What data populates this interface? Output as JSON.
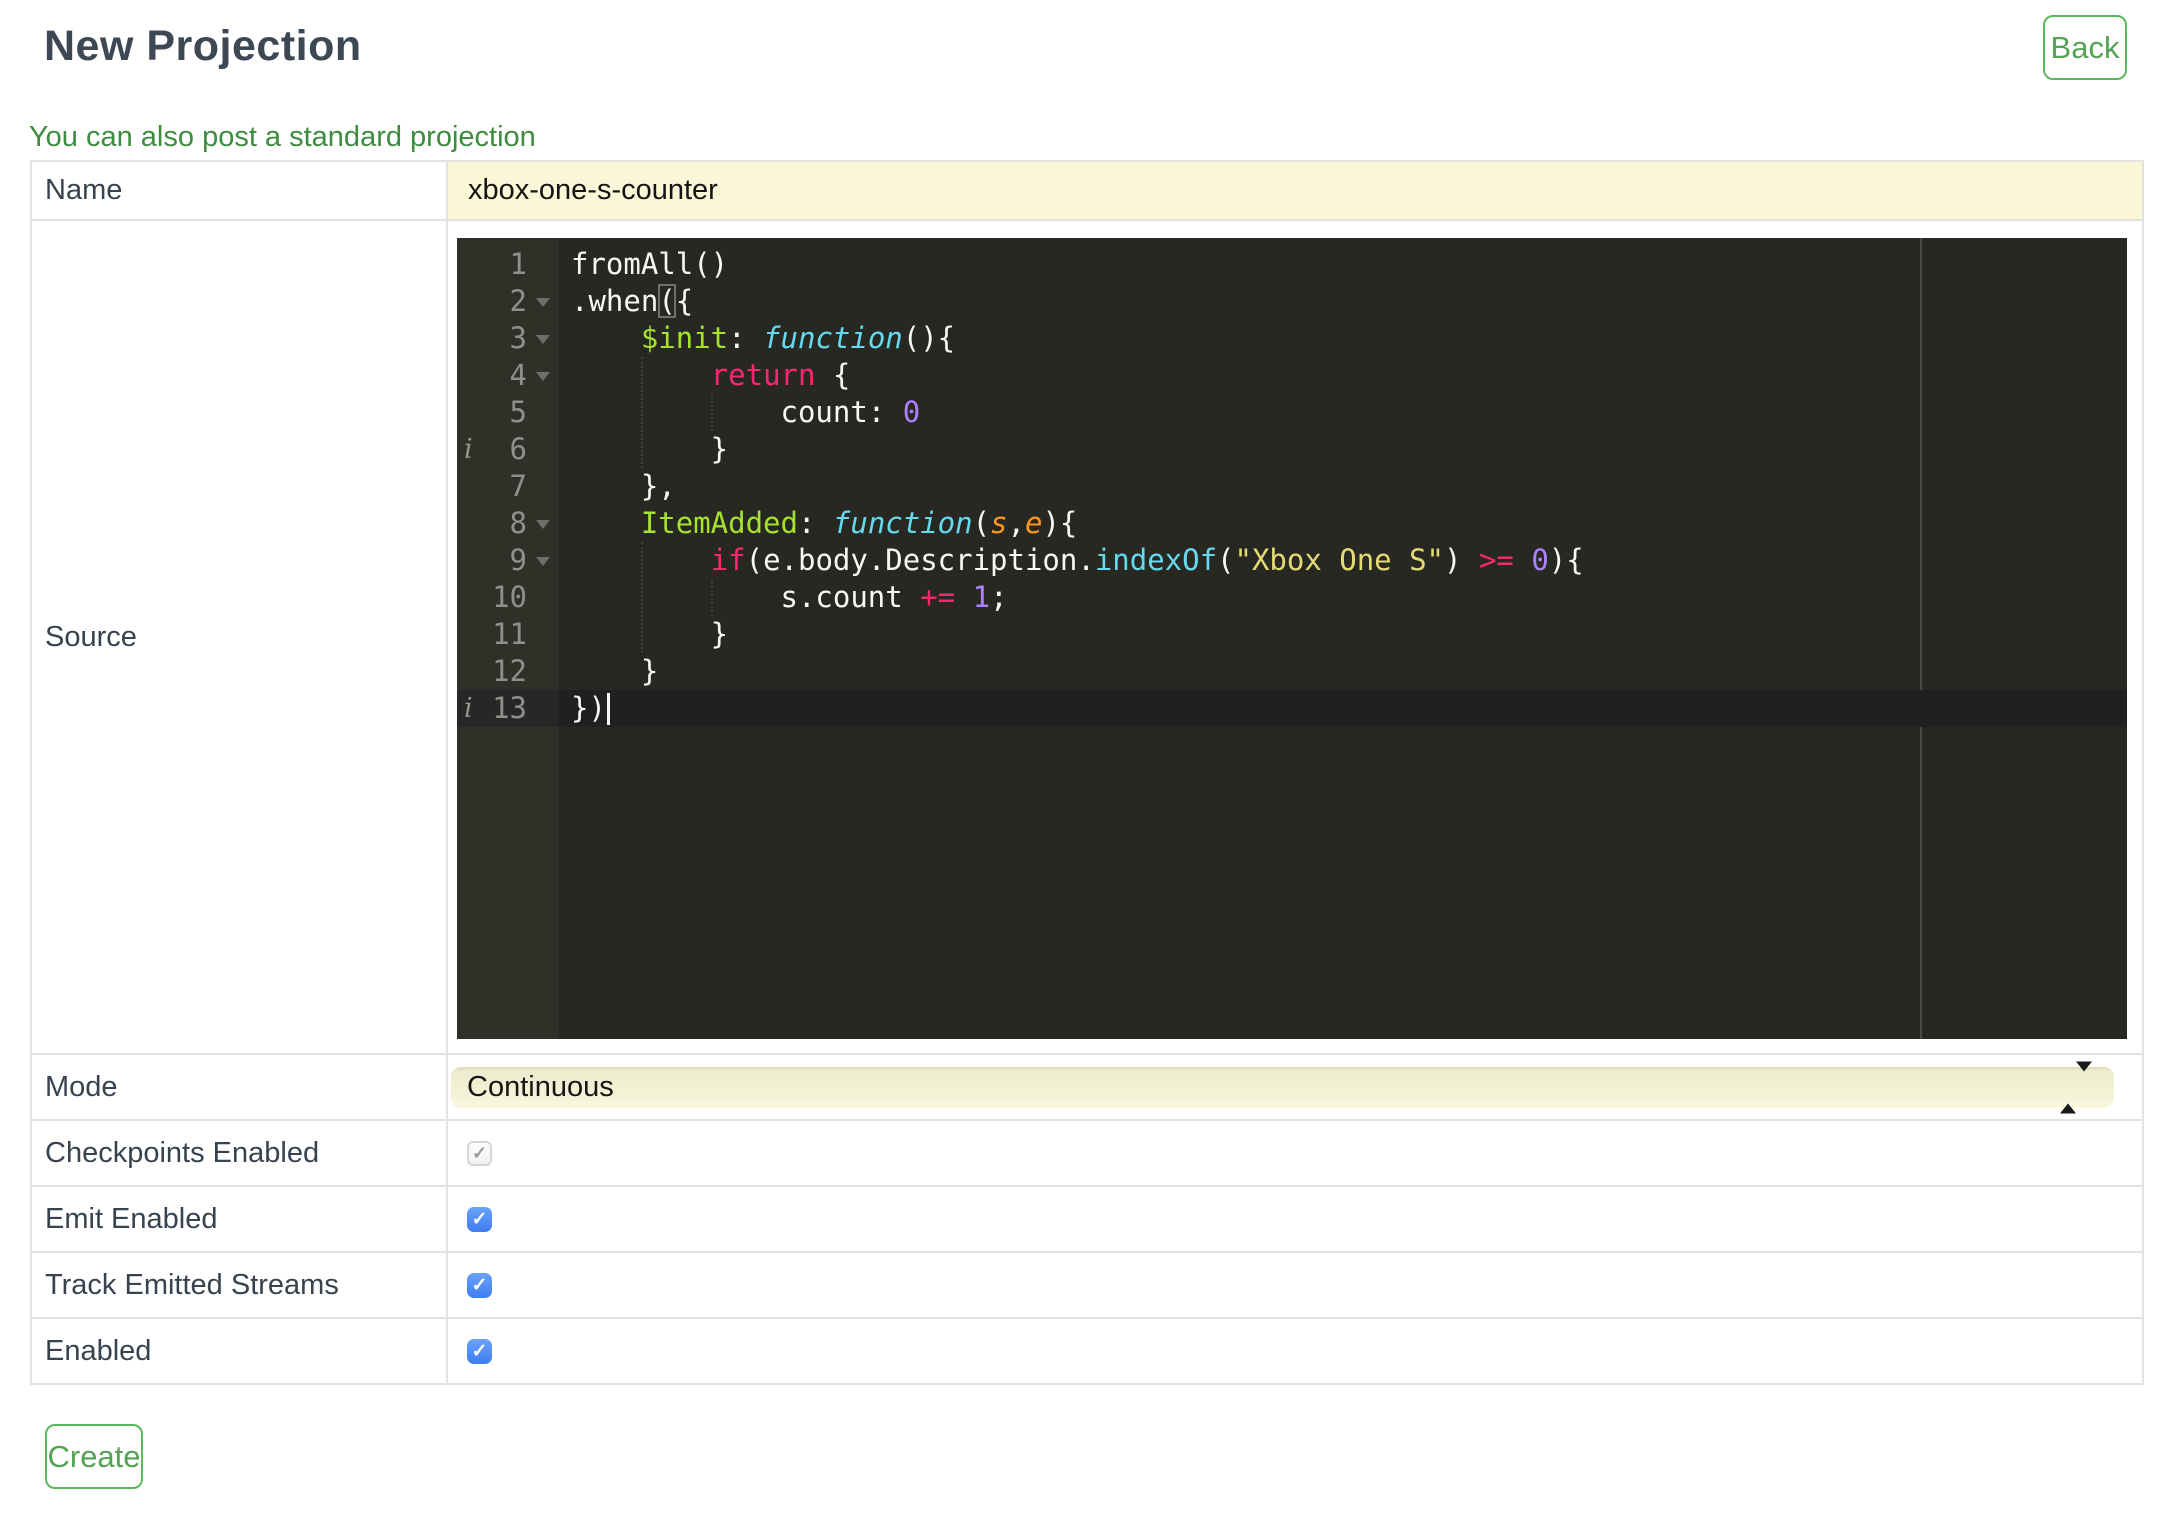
{
  "header": {
    "title": "New Projection",
    "back_label": "Back"
  },
  "intro_link": {
    "label": "You can also post a standard projection"
  },
  "form": {
    "name": {
      "label": "Name",
      "value": "xbox-one-s-counter"
    },
    "source": {
      "label": "Source"
    },
    "mode": {
      "label": "Mode",
      "value": "Continuous"
    },
    "checkpoints": {
      "label": "Checkpoints Enabled",
      "checked": true,
      "disabled": true
    },
    "emit": {
      "label": "Emit Enabled",
      "checked": true,
      "disabled": false
    },
    "track": {
      "label": "Track Emitted Streams",
      "checked": true,
      "disabled": false
    },
    "enabled": {
      "label": "Enabled",
      "checked": true,
      "disabled": false
    }
  },
  "actions": {
    "create_label": "Create"
  },
  "theme": {
    "accent_green": "#5cb85c",
    "link_green": "#3d8c40",
    "field_yellow": "#faf8d7",
    "checkbox_blue": "#3e7df2",
    "label_color": "#39434f"
  },
  "editor": {
    "language": "javascript",
    "theme": "monokai",
    "active_line": 13,
    "cursor": {
      "line": 13,
      "column": 2
    },
    "colors": {
      "background": "#272822",
      "gutter": "#2f3129",
      "plain": "#f8f8f2",
      "keyword": "#f92672",
      "entity": "#a6e22e",
      "support_function": "#66d9ef",
      "number": "#ae81ff",
      "string": "#e6db74",
      "parameter": "#fd971f",
      "line_number": "#8f908a"
    },
    "lines": [
      {
        "n": 1,
        "fold": false,
        "info": false,
        "segments": [
          [
            "fromAll()",
            "p"
          ]
        ]
      },
      {
        "n": 2,
        "fold": true,
        "info": false,
        "segments": [
          [
            ".when",
            "p"
          ],
          [
            "(",
            "b"
          ],
          [
            "{",
            "p"
          ]
        ]
      },
      {
        "n": 3,
        "fold": true,
        "info": false,
        "segments": [
          [
            "    ",
            "p"
          ],
          [
            "$init",
            "g"
          ],
          [
            ": ",
            "p"
          ],
          [
            "function",
            "fn"
          ],
          [
            "(){",
            "p"
          ]
        ]
      },
      {
        "n": 4,
        "fold": true,
        "info": false,
        "segments": [
          [
            "        ",
            "p"
          ],
          [
            "return",
            "k"
          ],
          [
            " {",
            "p"
          ]
        ]
      },
      {
        "n": 5,
        "fold": false,
        "info": false,
        "segments": [
          [
            "            count: ",
            "p"
          ],
          [
            "0",
            "num"
          ]
        ]
      },
      {
        "n": 6,
        "fold": false,
        "info": true,
        "segments": [
          [
            "        }",
            "p"
          ]
        ]
      },
      {
        "n": 7,
        "fold": false,
        "info": false,
        "segments": [
          [
            "    },",
            "p"
          ]
        ]
      },
      {
        "n": 8,
        "fold": true,
        "info": false,
        "segments": [
          [
            "    ",
            "p"
          ],
          [
            "ItemAdded",
            "g"
          ],
          [
            ": ",
            "p"
          ],
          [
            "function",
            "fn"
          ],
          [
            "(",
            "p"
          ],
          [
            "s",
            "prm"
          ],
          [
            ",",
            "p"
          ],
          [
            "e",
            "prm"
          ],
          [
            "){",
            "p"
          ]
        ]
      },
      {
        "n": 9,
        "fold": true,
        "info": false,
        "segments": [
          [
            "        ",
            "p"
          ],
          [
            "if",
            "k"
          ],
          [
            "(e.body.Description.",
            "p"
          ],
          [
            "indexOf",
            "sup"
          ],
          [
            "(",
            "p"
          ],
          [
            "\"Xbox One S\"",
            "str"
          ],
          [
            ") ",
            "p"
          ],
          [
            ">=",
            "k"
          ],
          [
            " ",
            "p"
          ],
          [
            "0",
            "num"
          ],
          [
            "){",
            "p"
          ]
        ]
      },
      {
        "n": 10,
        "fold": false,
        "info": false,
        "segments": [
          [
            "            s.count ",
            "p"
          ],
          [
            "+=",
            "k"
          ],
          [
            " ",
            "p"
          ],
          [
            "1",
            "num"
          ],
          [
            ";",
            "p"
          ]
        ]
      },
      {
        "n": 11,
        "fold": false,
        "info": false,
        "segments": [
          [
            "        }",
            "p"
          ]
        ]
      },
      {
        "n": 12,
        "fold": false,
        "info": false,
        "segments": [
          [
            "    }",
            "p"
          ]
        ]
      },
      {
        "n": 13,
        "fold": false,
        "info": true,
        "segments": [
          [
            "})",
            "p"
          ]
        ]
      }
    ]
  }
}
